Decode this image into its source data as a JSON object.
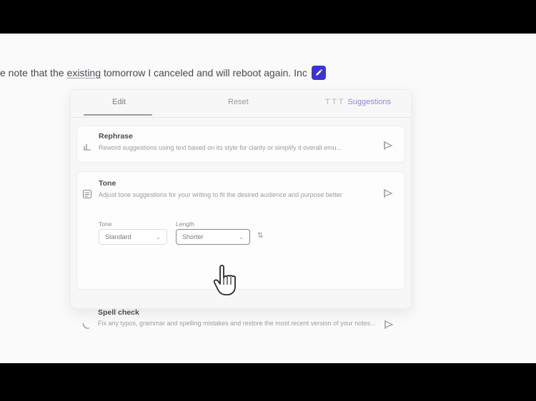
{
  "sentence": {
    "before": "e note that the",
    "underlined": "existing",
    "after": "tomorrow I canceled and will reboot again. Inc",
    "edit_icon": "pencil-icon"
  },
  "tabs": {
    "edit": "Edit",
    "reset": "Reset",
    "right_muted": "T T T",
    "right_accent": "Suggestions"
  },
  "rows": [
    {
      "title": "Rephrase",
      "desc": "Reword suggestions using text based on its style for clarity or simplify it overall emu...",
      "icon": "rephrase-icon",
      "action_icon": "send-icon"
    },
    {
      "title": "Tone",
      "desc": "Adjust tone suggestions for your writing to fit the desired audience and purpose better",
      "icon": "tone-icon",
      "action_icon": "send-icon"
    },
    {
      "title": "Spell check",
      "desc": "Fix any typos, grammar and spelling mistakes and restore the most recent version of your notes...",
      "icon": "spell-check-icon",
      "action_icon": "send-icon"
    }
  ],
  "fields": {
    "tone_label": "Tone",
    "tone_value": "Standard",
    "length_label": "Length",
    "length_value": "Shorter"
  },
  "colors": {
    "accent": "#3b34d0"
  }
}
